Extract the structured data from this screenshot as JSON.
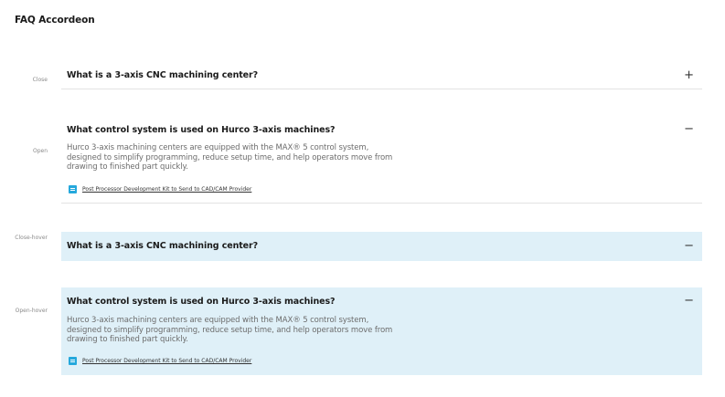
{
  "page": {
    "title": "FAQ Accordeon"
  },
  "states": [
    {
      "label": "Close"
    },
    {
      "label": "Open"
    },
    {
      "label": "Close-hover"
    },
    {
      "label": "Open-hover"
    }
  ],
  "items": [
    {
      "question": "What is a 3-axis CNC machining center?",
      "icon": "+",
      "icon_name": "plus-icon"
    },
    {
      "question": "What control system is used on Hurco 3-axis machines?",
      "icon": "−",
      "icon_name": "minus-icon",
      "answer": "Hurco 3-axis machining centers are equipped with the MAX® 5 control system, designed to simplify programming, reduce setup time, and help operators move from drawing to finished part quickly.",
      "attachment": "Post Processor Development Kit to Send to CAD/CAM Provider"
    },
    {
      "question": "What is a 3-axis CNC machining center?",
      "icon": "−",
      "icon_name": "minus-icon"
    },
    {
      "question": "What control system is used on Hurco 3-axis machines?",
      "icon": "−",
      "icon_name": "minus-icon",
      "answer": "Hurco 3-axis machining centers are equipped with the MAX® 5 control system, designed to simplify programming, reduce setup time, and help operators move from drawing to finished part quickly.",
      "attachment": "Post Processor Development Kit to Send to CAD/CAM Provider"
    }
  ],
  "colors": {
    "hover_bg": "#dff0f8",
    "attachment_icon": "#25a8dc",
    "divider": "#e3e3e3"
  }
}
